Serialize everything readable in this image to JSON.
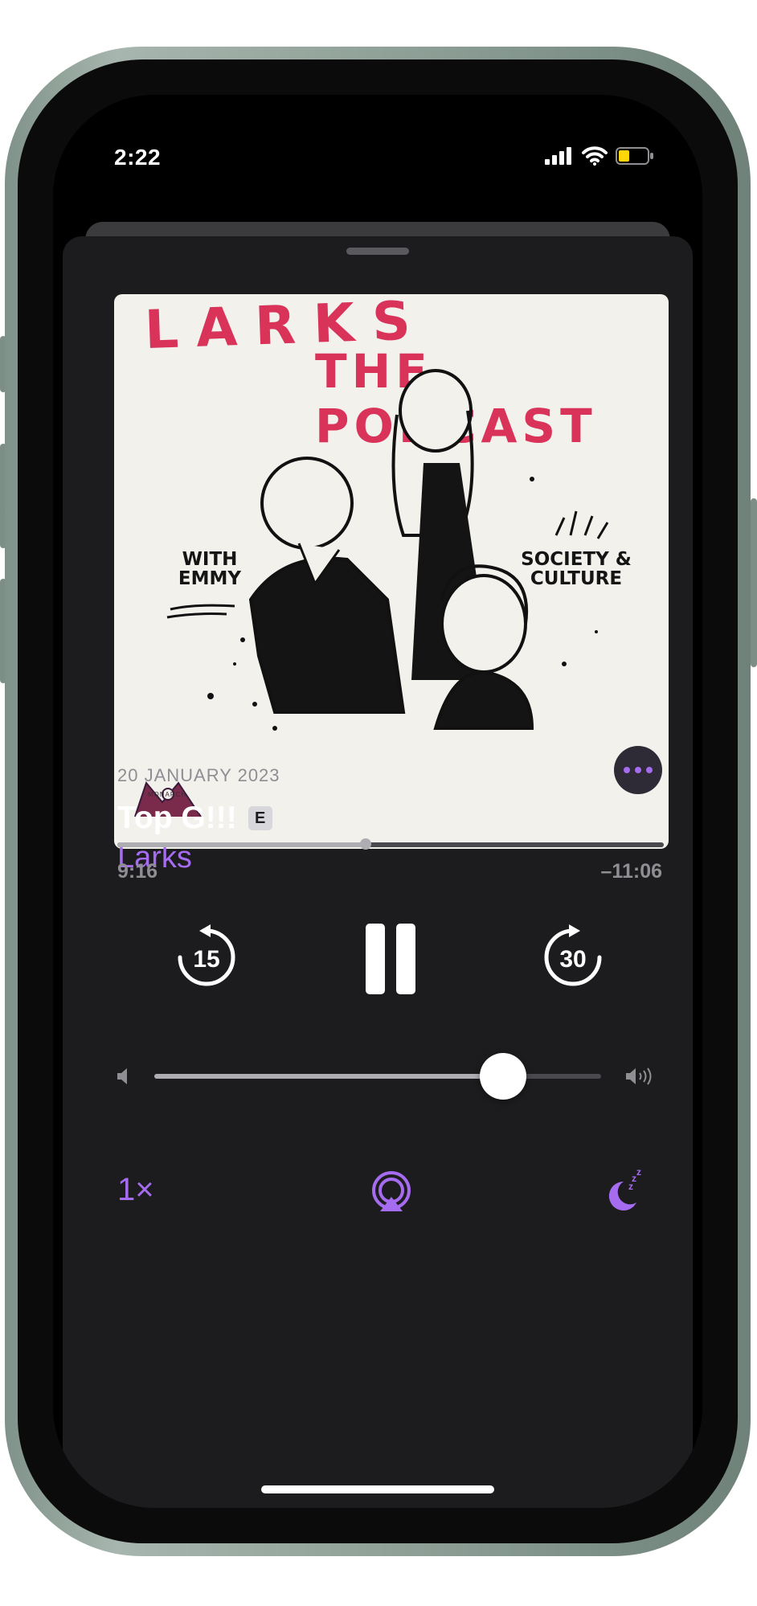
{
  "status_bar": {
    "time": "2:22"
  },
  "artwork": {
    "title_line1": "LARKS",
    "title_line2": "THE PODCAST",
    "note_left_1": "WITH",
    "note_left_2": "EMMY",
    "note_right_1": "SOCIETY &",
    "note_right_2": "CULTURE",
    "brand": "MONARCH"
  },
  "episode": {
    "date": "20 JANUARY 2023",
    "title": "Top G!!!",
    "explicit_badge": "E",
    "show": "Larks"
  },
  "playback": {
    "elapsed": "9:16",
    "remaining": "–11:06",
    "progress_fraction": 0.455,
    "volume_fraction": 0.78,
    "state": "playing"
  },
  "controls": {
    "skip_back_seconds": "15",
    "skip_forward_seconds": "30",
    "speed_label": "1×"
  },
  "icons": {
    "more": "more-icon",
    "airplay": "airplay-audio-icon",
    "sleep": "sleep-timer-icon",
    "volume_low": "volume-low-icon",
    "volume_high": "volume-high-icon"
  },
  "colors": {
    "accent": "#a66cf0",
    "sheet": "#1c1c1e",
    "art_title": "#d9335a"
  }
}
